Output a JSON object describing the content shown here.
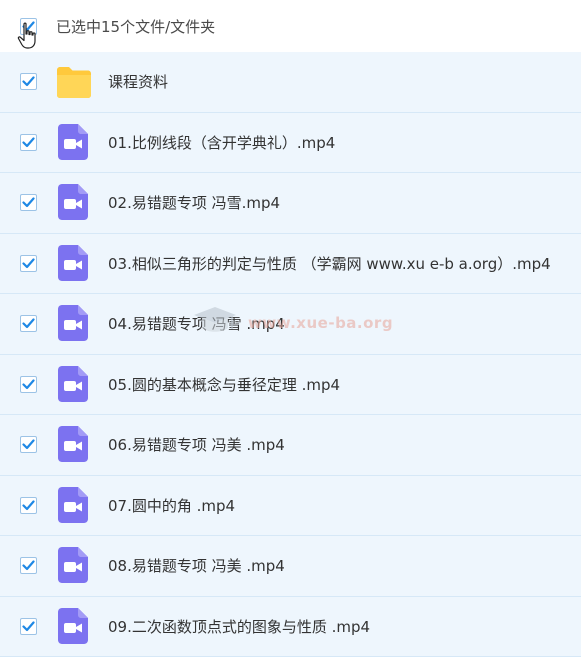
{
  "header": {
    "selection_text": "已选中15个文件/文件夹"
  },
  "files": [
    {
      "name": "课程资料",
      "type": "folder"
    },
    {
      "name": "01.比例线段（含开学典礼）.mp4",
      "type": "video"
    },
    {
      "name": "02.易错题专项 冯雪.mp4",
      "type": "video"
    },
    {
      "name": "03.相似三角形的判定与性质 （学霸网 www.xu e-b a.org）.mp4",
      "type": "video"
    },
    {
      "name": "04.易错题专项 冯雪 .mp4",
      "type": "video"
    },
    {
      "name": "05.圆的基本概念与垂径定理 .mp4",
      "type": "video"
    },
    {
      "name": "06.易错题专项 冯美 .mp4",
      "type": "video"
    },
    {
      "name": "07.圆中的角 .mp4",
      "type": "video"
    },
    {
      "name": "08.易错题专项 冯美 .mp4",
      "type": "video"
    },
    {
      "name": "09.二次函数顶点式的图象与性质 .mp4",
      "type": "video"
    }
  ],
  "watermark": {
    "text": "www.xue-ba.org"
  },
  "colors": {
    "row_bg": "#eef6fd",
    "checkbox_check": "#1e88e5",
    "folder": "#ffd04d",
    "video_icon": "#7c72f0"
  },
  "icons": {
    "checkbox": "checkbox-checked-icon",
    "folder": "folder-icon",
    "video": "video-file-icon",
    "cursor": "hand-cursor-icon"
  }
}
